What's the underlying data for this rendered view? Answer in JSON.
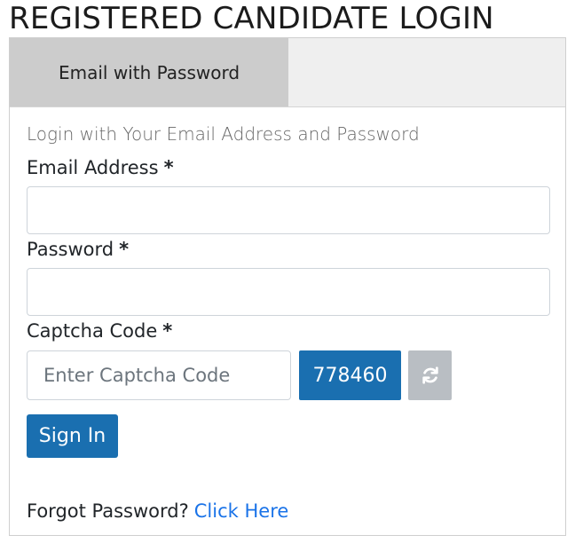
{
  "page": {
    "title": "REGISTERED CANDIDATE LOGIN"
  },
  "tabs": [
    {
      "label": "Email with Password",
      "active": true
    }
  ],
  "form": {
    "subtitle": "Login with Your Email Address and Password",
    "email": {
      "label": "Email Address",
      "required_mark": "*",
      "value": ""
    },
    "password": {
      "label": "Password",
      "required_mark": "*",
      "value": ""
    },
    "captcha": {
      "label": "Captcha Code",
      "required_mark": "*",
      "placeholder": "Enter Captcha Code",
      "code": "778460",
      "refresh_icon": "refresh-icon"
    },
    "submit_label": "Sign In",
    "forgot": {
      "text": "Forgot Password?",
      "link_label": "Click Here"
    }
  },
  "colors": {
    "primary": "#1a6fb0",
    "link": "#1a73e8",
    "tab_active": "#cccccc",
    "tab_bar": "#efefef",
    "refresh_button": "#b9bec3"
  }
}
